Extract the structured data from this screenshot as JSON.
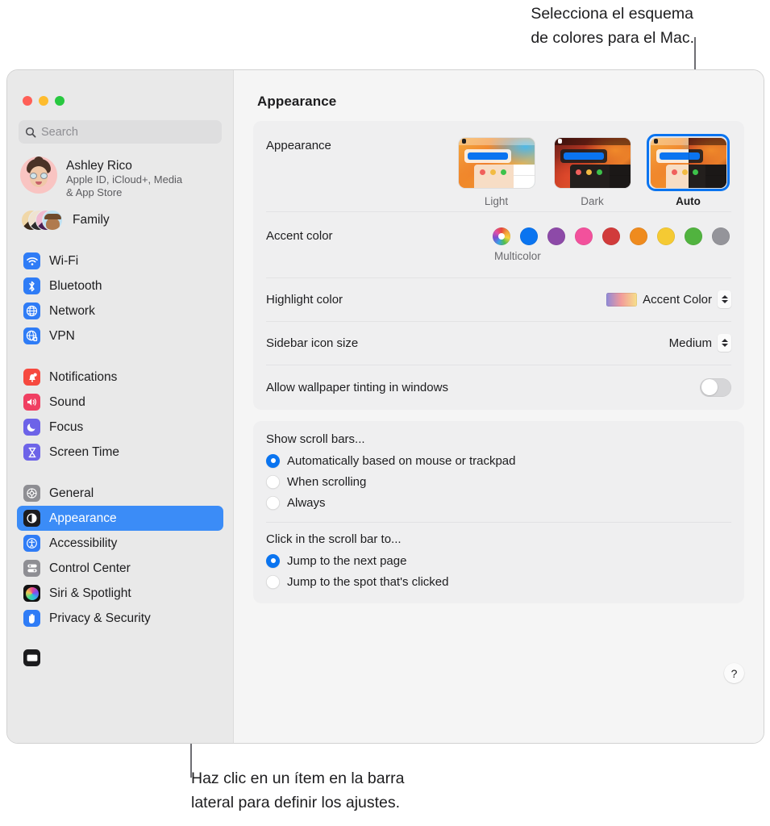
{
  "callouts": {
    "top": "Selecciona el esquema\nde colores para el Mac.",
    "bottom": "Haz clic en un ítem en la barra\nlateral para definir los ajustes."
  },
  "window": {
    "title": "Appearance",
    "traffic_lights": [
      "close",
      "minimize",
      "zoom"
    ]
  },
  "search": {
    "placeholder": "Search",
    "value": "",
    "icon": "search-icon"
  },
  "sidebar": {
    "account": {
      "name": "Ashley Rico",
      "subtitle": "Apple ID, iCloud+, Media\n& App Store"
    },
    "family": {
      "label": "Family"
    },
    "groups": [
      {
        "items": [
          {
            "label": "Wi-Fi",
            "icon": "wifi-icon",
            "color": "#2f7cf6",
            "selected": false
          },
          {
            "label": "Bluetooth",
            "icon": "bluetooth-icon",
            "color": "#2f7cf6",
            "selected": false
          },
          {
            "label": "Network",
            "icon": "globe-icon",
            "color": "#2f7cf6",
            "selected": false
          },
          {
            "label": "VPN",
            "icon": "vpn-globe-icon",
            "color": "#2f7cf6",
            "selected": false
          }
        ]
      },
      {
        "items": [
          {
            "label": "Notifications",
            "icon": "bell-icon",
            "color": "#f6493f",
            "selected": false
          },
          {
            "label": "Sound",
            "icon": "speaker-icon",
            "color": "#f03f62",
            "selected": false
          },
          {
            "label": "Focus",
            "icon": "moon-icon",
            "color": "#6d63e8",
            "selected": false
          },
          {
            "label": "Screen Time",
            "icon": "hourglass-icon",
            "color": "#6d63e8",
            "selected": false
          }
        ]
      },
      {
        "items": [
          {
            "label": "General",
            "icon": "gear-icon",
            "color": "#8e8e93",
            "selected": false
          },
          {
            "label": "Appearance",
            "icon": "appearance-icon",
            "color": "#1c1c1e",
            "selected": true
          },
          {
            "label": "Accessibility",
            "icon": "accessibility-icon",
            "color": "#2f7cf6",
            "selected": false
          },
          {
            "label": "Control Center",
            "icon": "control-center-icon",
            "color": "#8e8e93",
            "selected": false
          },
          {
            "label": "Siri & Spotlight",
            "icon": "siri-icon",
            "color": "#1c1c1e",
            "selected": false
          },
          {
            "label": "Privacy & Security",
            "icon": "hand-icon",
            "color": "#2f7cf6",
            "selected": false
          }
        ]
      }
    ]
  },
  "appearance_row": {
    "label": "Appearance",
    "options": [
      {
        "name": "Light",
        "selected": false
      },
      {
        "name": "Dark",
        "selected": false
      },
      {
        "name": "Auto",
        "selected": true
      }
    ]
  },
  "accent_row": {
    "label": "Accent color",
    "caption": "Multicolor",
    "swatches": [
      {
        "name": "Multicolor",
        "color": "multicolor",
        "selected": true
      },
      {
        "name": "Blue",
        "color": "#0a74f0"
      },
      {
        "name": "Purple",
        "color": "#8d4aa8"
      },
      {
        "name": "Pink",
        "color": "#f2519c"
      },
      {
        "name": "Red",
        "color": "#d13b3b"
      },
      {
        "name": "Orange",
        "color": "#ef8b1e"
      },
      {
        "name": "Yellow",
        "color": "#f5ca33"
      },
      {
        "name": "Green",
        "color": "#51b33f"
      },
      {
        "name": "Graphite",
        "color": "#94949a"
      }
    ]
  },
  "highlight_row": {
    "label": "Highlight color",
    "value": "Accent Color"
  },
  "sidebar_size_row": {
    "label": "Sidebar icon size",
    "value": "Medium"
  },
  "tint_row": {
    "label": "Allow wallpaper tinting in windows",
    "enabled": false
  },
  "scroll_bars": {
    "heading": "Show scroll bars...",
    "options": [
      {
        "label": "Automatically based on mouse or trackpad",
        "selected": true
      },
      {
        "label": "When scrolling",
        "selected": false
      },
      {
        "label": "Always",
        "selected": false
      }
    ]
  },
  "scroll_click": {
    "heading": "Click in the scroll bar to...",
    "options": [
      {
        "label": "Jump to the next page",
        "selected": true
      },
      {
        "label": "Jump to the spot that's clicked",
        "selected": false
      }
    ]
  },
  "help": {
    "label": "?"
  }
}
